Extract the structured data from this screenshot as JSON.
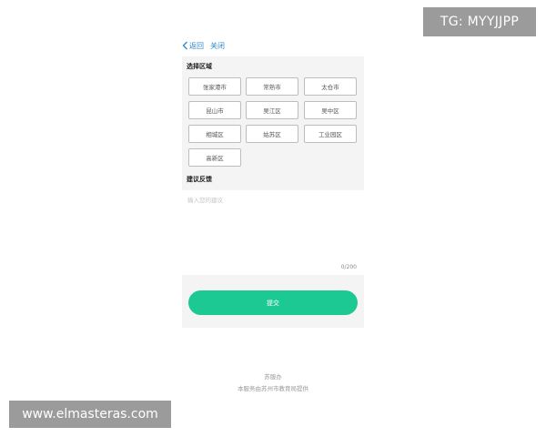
{
  "watermarks": {
    "top": "TG: MYYJJPP",
    "bottom": "www.elmasteras.com"
  },
  "nav": {
    "back_label": "返回",
    "close_label": "关闭"
  },
  "region_section": {
    "title": "选择区域",
    "districts": [
      "张家港市",
      "常熟市",
      "太仓市",
      "昆山市",
      "吴江区",
      "吴中区",
      "相城区",
      "姑苏区",
      "工业园区",
      "高新区"
    ]
  },
  "feedback_section": {
    "title": "建议反馈",
    "placeholder": "输入您的建议",
    "value": "",
    "counter": "0/200"
  },
  "submit_label": "提交",
  "footer": {
    "line1": "苏服办",
    "line2": "本服务由苏州市教育局提供"
  },
  "colors": {
    "accent": "#1dc992",
    "link": "#2e86c9",
    "panel_bg": "#f4f4f4"
  }
}
